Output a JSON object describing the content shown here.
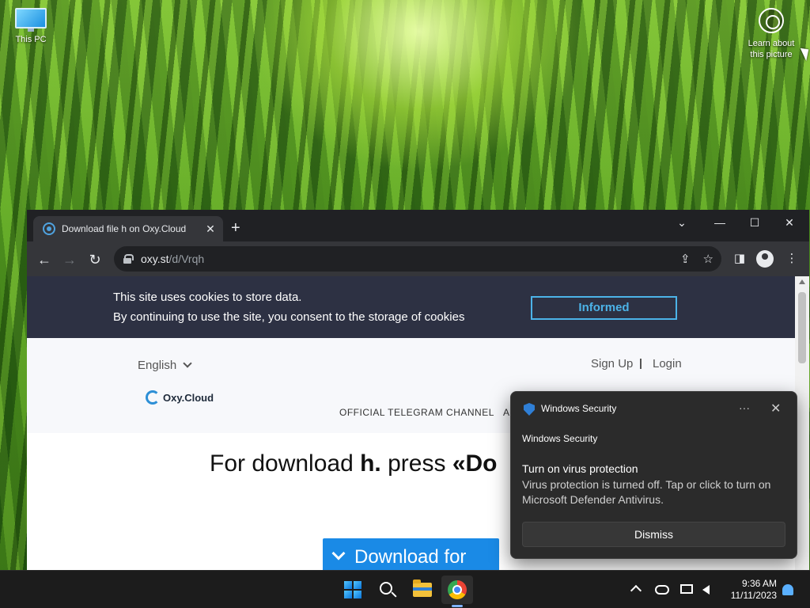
{
  "desktop": {
    "icons": {
      "this_pc": "This PC",
      "learn_about_picture": "Learn about this picture"
    }
  },
  "browser": {
    "tab": {
      "title": "Download file h on Oxy.Cloud",
      "close": "✕"
    },
    "new_tab": "+",
    "window_controls": {
      "tab_search": "⌄",
      "minimize": "—",
      "maximize": "☐",
      "close": "✕"
    },
    "toolbar": {
      "back": "←",
      "forward": "→",
      "reload": "↻",
      "url_host": "oxy.st",
      "url_path": "/d/Vrqh",
      "share": "⇪",
      "bookmark": "☆",
      "side_panel": "◨",
      "menu": "⋮"
    }
  },
  "page": {
    "cookie": {
      "line1": "This site uses cookies to store data.",
      "line2": "By continuing to use the site, you consent to the storage of cookies",
      "button": "Informed"
    },
    "header": {
      "language": "English",
      "sign_up": "Sign Up",
      "login": "Login",
      "logo_text": "Oxy.Cloud",
      "nav_telegram": "OFFICIAL TELEGRAM CHANNEL",
      "nav_more": "A"
    },
    "headline": {
      "prefix": "For download ",
      "filename": "h.",
      "suffix": " press ",
      "quoted": "«Do"
    },
    "download_button": "Download for"
  },
  "toast": {
    "app_name": "Windows Security",
    "more": "···",
    "close": "✕",
    "subtitle": "Windows Security",
    "title": "Turn on virus protection",
    "body": "Virus protection is turned off. Tap or click to turn on Microsoft Defender Antivirus.",
    "dismiss": "Dismiss"
  },
  "taskbar": {
    "time": "9:36 AM",
    "date": "11/11/2023"
  },
  "colors": {
    "cookie_bar": "#2d3143",
    "accent_blue": "#1a8ae6",
    "informed_border": "#4cb3e8",
    "toast_bg": "#2b2b2b"
  }
}
